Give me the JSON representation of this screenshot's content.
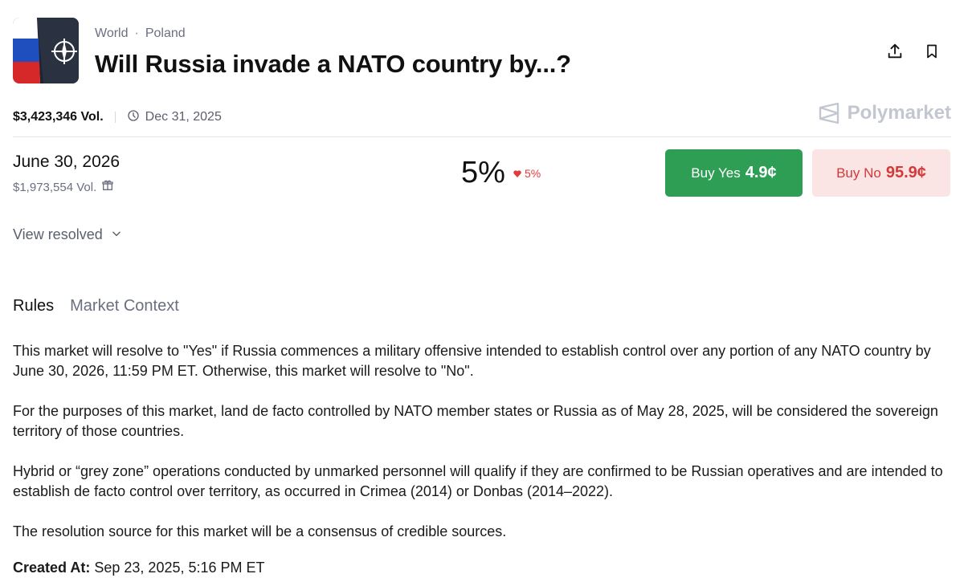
{
  "breadcrumb": {
    "category": "World",
    "separator": "·",
    "subcategory": "Poland"
  },
  "market": {
    "title": "Will Russia invade a NATO country by...?",
    "volume": "$3,423,346 Vol.",
    "end_date": "Dec 31, 2025",
    "brand": "Polymarket"
  },
  "outcome": {
    "title": "June 30, 2026",
    "volume": "$1,973,554 Vol.",
    "probability": "5%",
    "change": "5%",
    "change_direction": "down",
    "buy_yes_label": "Buy Yes",
    "buy_yes_price": "4.9¢",
    "buy_no_label": "Buy No",
    "buy_no_price": "95.9¢"
  },
  "view_resolved": "View resolved",
  "tabs": [
    {
      "label": "Rules",
      "active": true
    },
    {
      "label": "Market Context",
      "active": false
    }
  ],
  "rules": [
    "This market will resolve to \"Yes\" if Russia commences a military offensive intended to establish control over any portion of any NATO country by June 30, 2026, 11:59 PM ET. Otherwise, this market will resolve to \"No\".",
    "For the purposes of this market, land de facto controlled by NATO member states or Russia as of May 28, 2025, will be considered the sovereign territory of those countries.",
    "Hybrid or “grey zone” operations conducted by unmarked personnel will qualify if they are confirmed to be Russian operatives and are intended to establish de facto control over territory, as occurred in Crimea (2014) or Donbas (2014–2022).",
    "The resolution source for this market will be a consensus of credible sources."
  ],
  "created": {
    "label": "Created At:",
    "value": "Sep 23, 2025, 5:16 PM ET"
  },
  "icons": {
    "share": "share-icon",
    "bookmark": "bookmark-icon",
    "clock": "clock-icon",
    "gift": "gift-icon",
    "chevron": "chevron-down-icon",
    "heart": "heart-icon"
  },
  "colors": {
    "yes": "#2f9e55",
    "no_bg": "#fbe4e4",
    "no_text": "#d23a3a",
    "down": "#e23b3b"
  }
}
